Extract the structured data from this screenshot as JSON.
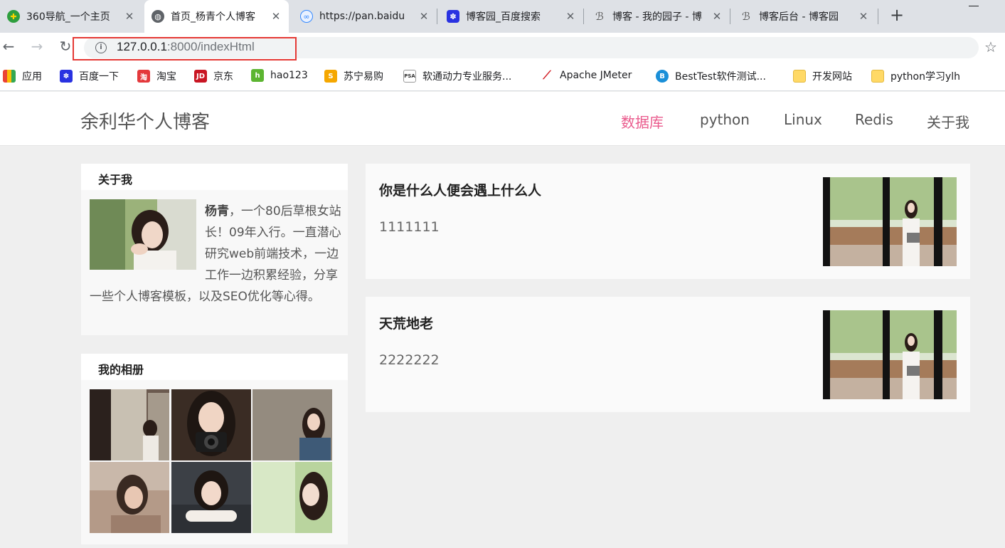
{
  "browser": {
    "tabs": [
      {
        "title": "360导航_一个主页",
        "icon": "360-navigation-icon"
      },
      {
        "title": "首页_杨青个人博客",
        "icon": "globe-icon"
      },
      {
        "title": "https://pan.baidu",
        "icon": "baidu-pan-icon"
      },
      {
        "title": "博客园_百度搜索",
        "icon": "baidu-paw-icon"
      },
      {
        "title": "博客 - 我的园子 - 博",
        "icon": "cnblogs-icon"
      },
      {
        "title": "博客后台 - 博客园",
        "icon": "cnblogs-icon"
      }
    ],
    "url_host": "127.0.0.1",
    "url_rest": ":8000/indexHtml",
    "bookmarks": [
      {
        "label": "应用",
        "icon": "apps-grid-icon"
      },
      {
        "label": "百度一下",
        "icon": "baidu-paw-icon"
      },
      {
        "label": "淘宝",
        "icon": "taobao-icon"
      },
      {
        "label": "京东",
        "icon": "jd-icon"
      },
      {
        "label": "hao123",
        "icon": "hao123-icon"
      },
      {
        "label": "苏宁易购",
        "icon": "suning-icon"
      },
      {
        "label": "软通动力专业服务...",
        "icon": "psa-icon"
      },
      {
        "label": "Apache JMeter",
        "icon": "jmeter-feather-icon"
      },
      {
        "label": "BestTest软件测试...",
        "icon": "besttest-icon"
      },
      {
        "label": "开发网站",
        "icon": "folder-icon"
      },
      {
        "label": "python学习ylh",
        "icon": "folder-icon"
      }
    ]
  },
  "site": {
    "logo": "余利华个人博客",
    "nav": [
      "数据库",
      "python",
      "Linux",
      "Redis",
      "关于我"
    ],
    "nav_active_color": "#ea5b8d"
  },
  "sidebar": {
    "about_title": "关于我",
    "about_name": "杨青",
    "about_text": "，一个80后草根女站长！09年入行。一直潜心研究web前端技术，一边工作一边积累经验，分享一些个人博客模板，以及SEO优化等心得。",
    "album_title": "我的相册"
  },
  "posts": [
    {
      "title": "你是什么人便会遇上什么人",
      "body": "1111111"
    },
    {
      "title": "天荒地老",
      "body": "2222222"
    }
  ]
}
